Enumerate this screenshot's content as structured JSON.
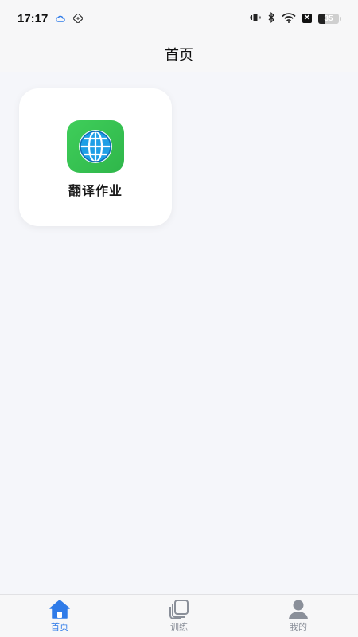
{
  "status_bar": {
    "time": "17:17",
    "battery_level": "35",
    "icons": [
      "cloud-icon",
      "app-badge-icon",
      "vibrate-icon",
      "bluetooth-icon",
      "wifi-icon",
      "close-box-icon",
      "battery-icon"
    ]
  },
  "nav": {
    "title": "首页"
  },
  "grid": {
    "items": [
      {
        "label": "翻译作业",
        "icon": "globe-icon"
      }
    ]
  },
  "tabbar": {
    "items": [
      {
        "label": "首页",
        "icon": "home-icon",
        "active": true
      },
      {
        "label": "训练",
        "icon": "cards-icon",
        "active": false
      },
      {
        "label": "我的",
        "icon": "user-icon",
        "active": false
      }
    ]
  },
  "colors": {
    "accent": "#2f7be8",
    "inactive": "#8a8f99",
    "icon_green": "#3fce5a",
    "background": "#f5f6fa"
  }
}
